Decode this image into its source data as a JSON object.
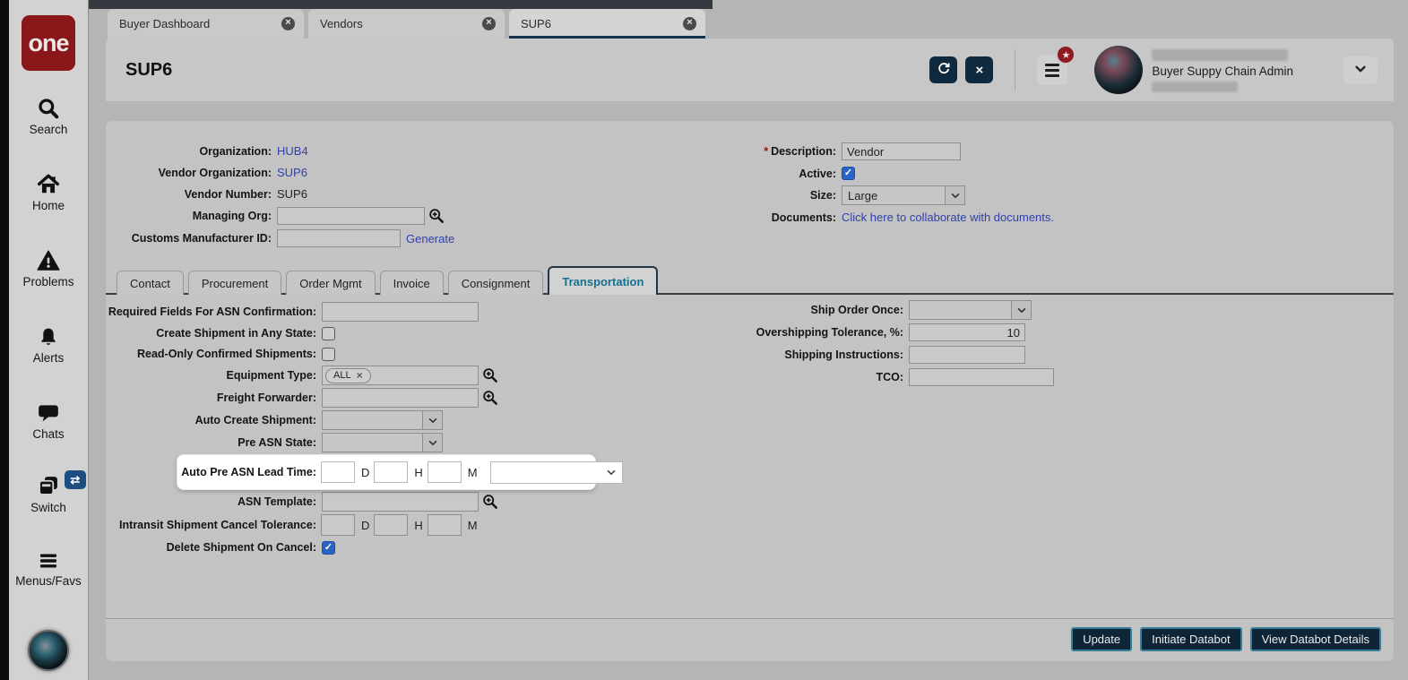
{
  "icons": {
    "close_glyph": "×",
    "check_glyph": "✓",
    "star_glyph": "★",
    "switch_badge_glyph": "⇄"
  },
  "sidebar": {
    "logo": "one",
    "items": [
      {
        "label": "Search"
      },
      {
        "label": "Home"
      },
      {
        "label": "Problems"
      },
      {
        "label": "Alerts"
      },
      {
        "label": "Chats"
      },
      {
        "label": "Switch"
      },
      {
        "label": "Menus/Favs"
      }
    ]
  },
  "tabs": {
    "items": [
      {
        "label": "Buyer Dashboard"
      },
      {
        "label": "Vendors"
      },
      {
        "label": "SUP6"
      }
    ]
  },
  "header": {
    "title": "SUP6",
    "user_role": "Buyer Suppy Chain Admin"
  },
  "general": {
    "organization": {
      "label": "Organization:",
      "value": "HUB4"
    },
    "vendor_organization": {
      "label": "Vendor Organization:",
      "value": "SUP6"
    },
    "vendor_number": {
      "label": "Vendor Number:",
      "value": "SUP6"
    },
    "managing_org": {
      "label": "Managing Org:",
      "value": ""
    },
    "customs_manufacturer_id": {
      "label": "Customs Manufacturer ID:",
      "value": "",
      "action": "Generate"
    },
    "description": {
      "label": "Description:",
      "required_mark": "*",
      "value": "Vendor"
    },
    "active": {
      "label": "Active:",
      "checked": true
    },
    "size": {
      "label": "Size:",
      "value": "Large"
    },
    "documents": {
      "label": "Documents:",
      "link": "Click here to collaborate with documents."
    }
  },
  "sub_tabs": {
    "items": [
      {
        "label": "Contact"
      },
      {
        "label": "Procurement"
      },
      {
        "label": "Order Mgmt"
      },
      {
        "label": "Invoice"
      },
      {
        "label": "Consignment"
      },
      {
        "label": "Transportation"
      }
    ]
  },
  "transportation": {
    "units": {
      "d": "D",
      "h": "H",
      "m": "M"
    },
    "required_fields_for_asn_confirmation": {
      "label": "Required Fields For ASN Confirmation:",
      "value": ""
    },
    "create_shipment_in_any_state": {
      "label": "Create Shipment in Any State:",
      "checked": false
    },
    "read_only_confirmed_shipments": {
      "label": "Read-Only Confirmed Shipments:",
      "checked": false
    },
    "equipment_type": {
      "label": "Equipment Type:",
      "tag": "ALL"
    },
    "freight_forwarder": {
      "label": "Freight Forwarder:",
      "value": ""
    },
    "auto_create_shipment": {
      "label": "Auto Create Shipment:",
      "value": ""
    },
    "pre_asn_state": {
      "label": "Pre ASN State:",
      "value": ""
    },
    "auto_pre_asn_lead_time": {
      "label": "Auto Pre ASN Lead Time:",
      "d": "",
      "h": "",
      "m": "",
      "uom": ""
    },
    "asn_template": {
      "label": "ASN Template:",
      "value": ""
    },
    "intransit_shipment_cancel_tolerance": {
      "label": "Intransit Shipment Cancel Tolerance:",
      "d": "",
      "h": "",
      "m": ""
    },
    "delete_shipment_on_cancel": {
      "label": "Delete Shipment On Cancel:",
      "checked": true
    },
    "ship_order_once": {
      "label": "Ship Order Once:",
      "value": ""
    },
    "overshipping_tolerance": {
      "label": "Overshipping Tolerance, %:",
      "value": "10"
    },
    "shipping_instructions": {
      "label": "Shipping Instructions:",
      "value": ""
    },
    "tco": {
      "label": "TCO:",
      "value": ""
    }
  },
  "footer": {
    "update": "Update",
    "initiate_databot": "Initiate Databot",
    "view_databot_details": "View Databot Details"
  },
  "colors": {
    "accent_navy": "#0f2a3f",
    "link_blue": "#3240ad",
    "active_tab_teal": "#15718e",
    "checkbox_blue": "#2b63c4",
    "badge_red": "#8e1b22",
    "logo_red": "#8a181b",
    "highlight_white": "#ffffff"
  }
}
